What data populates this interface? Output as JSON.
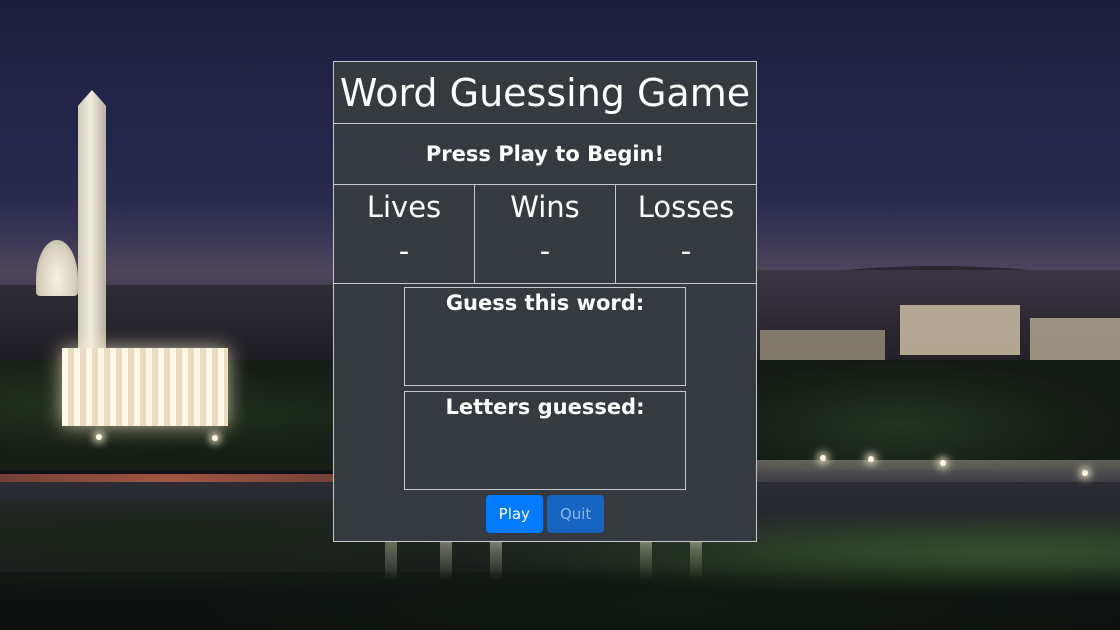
{
  "game": {
    "title": "Word Guessing Game",
    "status": "Press Play to Begin!",
    "stats": [
      {
        "label": "Lives",
        "value": "-"
      },
      {
        "label": "Wins",
        "value": "-"
      },
      {
        "label": "Losses",
        "value": "-"
      }
    ],
    "guess_word": {
      "label": "Guess this word:",
      "value": ""
    },
    "letters_guessed": {
      "label": "Letters guessed:",
      "value": ""
    },
    "buttons": {
      "play": "Play",
      "quit": "Quit"
    }
  },
  "colors": {
    "panel_bg": "#343a40",
    "panel_border": "#c7c9cc",
    "play_button": "#007bff",
    "quit_button": "#1464c0"
  },
  "icons": {
    "background": "city-night-landscape"
  }
}
